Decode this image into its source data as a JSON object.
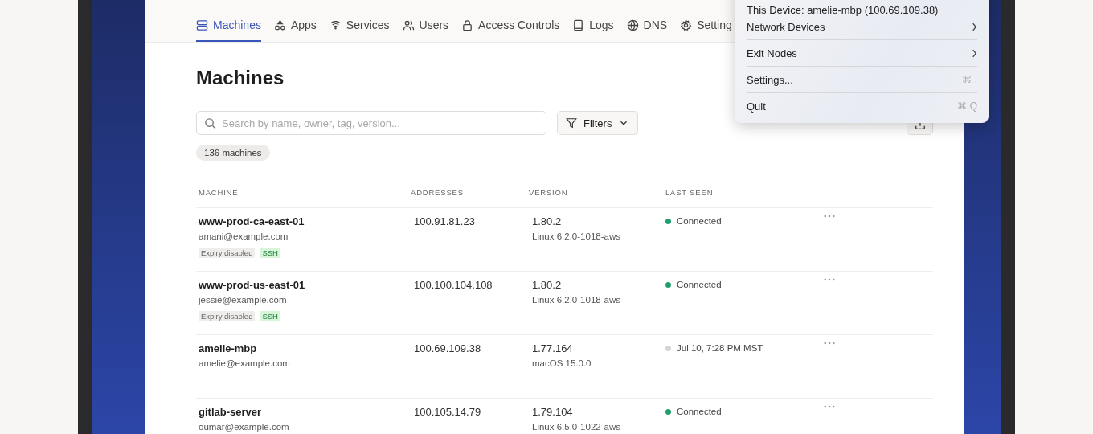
{
  "tabs": [
    {
      "label": "Machines",
      "selected": true
    },
    {
      "label": "Apps",
      "selected": false
    },
    {
      "label": "Services",
      "selected": false
    },
    {
      "label": "Users",
      "selected": false
    },
    {
      "label": "Access Controls",
      "selected": false
    },
    {
      "label": "Logs",
      "selected": false
    },
    {
      "label": "DNS",
      "selected": false
    },
    {
      "label": "Setting",
      "selected": false
    }
  ],
  "page_title": "Machines",
  "search": {
    "placeholder": "Search by name, owner, tag, version..."
  },
  "filters_button": "Filters",
  "count_badge": "136 machines",
  "table": {
    "columns": [
      "MACHINE",
      "ADDRESSES",
      "VERSION",
      "LAST SEEN"
    ],
    "rows": [
      {
        "name": "www-prod-ca-east-01",
        "owner": "amani@example.com",
        "tags": [
          {
            "label": "Expiry disabled",
            "kind": "muted"
          },
          {
            "label": "SSH",
            "kind": "ssh"
          }
        ],
        "address": "100.91.81.23",
        "version": "1.80.2",
        "os": "Linux 6.2.0-1018-aws",
        "status": "Connected",
        "color": "#1f9e6e"
      },
      {
        "name": "www-prod-us-east-01",
        "owner": "jessie@example.com",
        "tags": [
          {
            "label": "Expiry disabled",
            "kind": "muted"
          },
          {
            "label": "SSH",
            "kind": "ssh"
          }
        ],
        "address": "100.100.104.108",
        "version": "1.80.2",
        "os": "Linux 6.2.0-1018-aws",
        "status": "Connected",
        "color": "#1f9e6e"
      },
      {
        "name": "amelie-mbp",
        "owner": "amelie@example.com",
        "tags": [],
        "address": "100.69.109.38",
        "version": "1.77.164",
        "os": "macOS 15.0.0",
        "status": "Jul 10, 7:28 PM MST",
        "color": "#d4d4d4"
      },
      {
        "name": "gitlab-server",
        "owner": "oumar@example.com",
        "tags": [],
        "address": "100.105.14.79",
        "version": "1.79.104",
        "os": "Linux 6.5.0-1022-aws",
        "status": "Connected",
        "color": "#1f9e6e"
      }
    ]
  },
  "menu": {
    "items": [
      {
        "label": "This Device: amelie-mbp (100.69.109.38)",
        "kind": "info"
      },
      {
        "label": "Network Devices",
        "kind": "submenu"
      },
      {
        "label": "Exit Nodes",
        "kind": "submenu",
        "separator": true
      },
      {
        "label": "Settings...",
        "kind": "shortcut",
        "shortcut": "⌘ ,",
        "separator": true
      },
      {
        "label": "Quit",
        "kind": "shortcut",
        "shortcut": "⌘ Q",
        "separator": true
      }
    ]
  }
}
